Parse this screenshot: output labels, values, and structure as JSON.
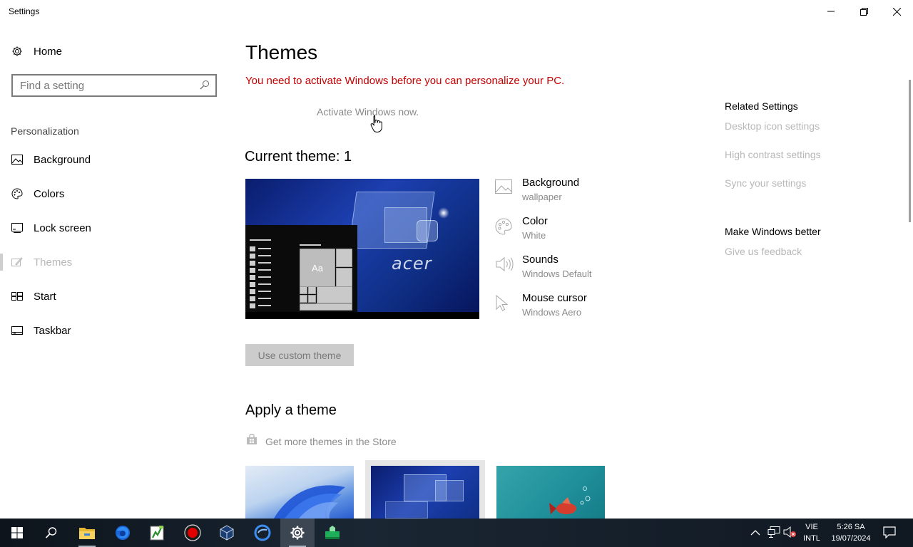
{
  "window": {
    "title": "Settings",
    "minimize_icon": "minimize-icon",
    "restore_icon": "restore-icon",
    "close_icon": "close-icon"
  },
  "sidebar": {
    "home_label": "Home",
    "search_placeholder": "Find a setting",
    "section_label": "Personalization",
    "items": [
      {
        "label": "Background",
        "icon": "picture-icon"
      },
      {
        "label": "Colors",
        "icon": "palette-icon"
      },
      {
        "label": "Lock screen",
        "icon": "lock-screen-icon"
      },
      {
        "label": "Themes",
        "icon": "brush-icon",
        "selected": true
      },
      {
        "label": "Start",
        "icon": "start-tiles-icon"
      },
      {
        "label": "Taskbar",
        "icon": "taskbar-icon"
      }
    ]
  },
  "main": {
    "page_title": "Themes",
    "activation_warning": "You need to activate Windows before you can personalize your PC.",
    "activate_link": "Activate Windows now.",
    "current_theme_heading": "Current theme: 1",
    "preview_brand": "acer",
    "preview_tile_text": "Aa",
    "properties": [
      {
        "title": "Background",
        "value": "wallpaper",
        "icon": "picture-icon"
      },
      {
        "title": "Color",
        "value": "White",
        "icon": "palette-icon"
      },
      {
        "title": "Sounds",
        "value": "Windows Default",
        "icon": "speaker-icon"
      },
      {
        "title": "Mouse cursor",
        "value": "Windows Aero",
        "icon": "cursor-icon"
      }
    ],
    "custom_theme_button": "Use custom theme",
    "apply_heading": "Apply a theme",
    "store_link": "Get more themes in the Store",
    "themes": [
      {
        "name": "windows-11-bloom",
        "selected": false
      },
      {
        "name": "acer-blue",
        "selected": true
      },
      {
        "name": "teal-fish",
        "selected": false
      }
    ]
  },
  "related": {
    "heading": "Related Settings",
    "links": [
      "Desktop icon settings",
      "High contrast settings",
      "Sync your settings"
    ],
    "better_heading": "Make Windows better",
    "feedback_link": "Give us feedback"
  },
  "taskbar": {
    "apps": [
      "windows-start-icon",
      "search-icon",
      "file-explorer-icon",
      "firefox-icon",
      "notepad-plus-icon",
      "record-icon",
      "virtualbox-icon",
      "browser-icon",
      "settings-icon",
      "green-app-icon"
    ],
    "language_top": "VIE",
    "language_bottom": "INTL",
    "time": "5:26 SA",
    "date": "19/07/2024"
  },
  "colors": {
    "warning": "#c50000",
    "muted": "#8a8a8a",
    "taskbar": "#111a24"
  }
}
